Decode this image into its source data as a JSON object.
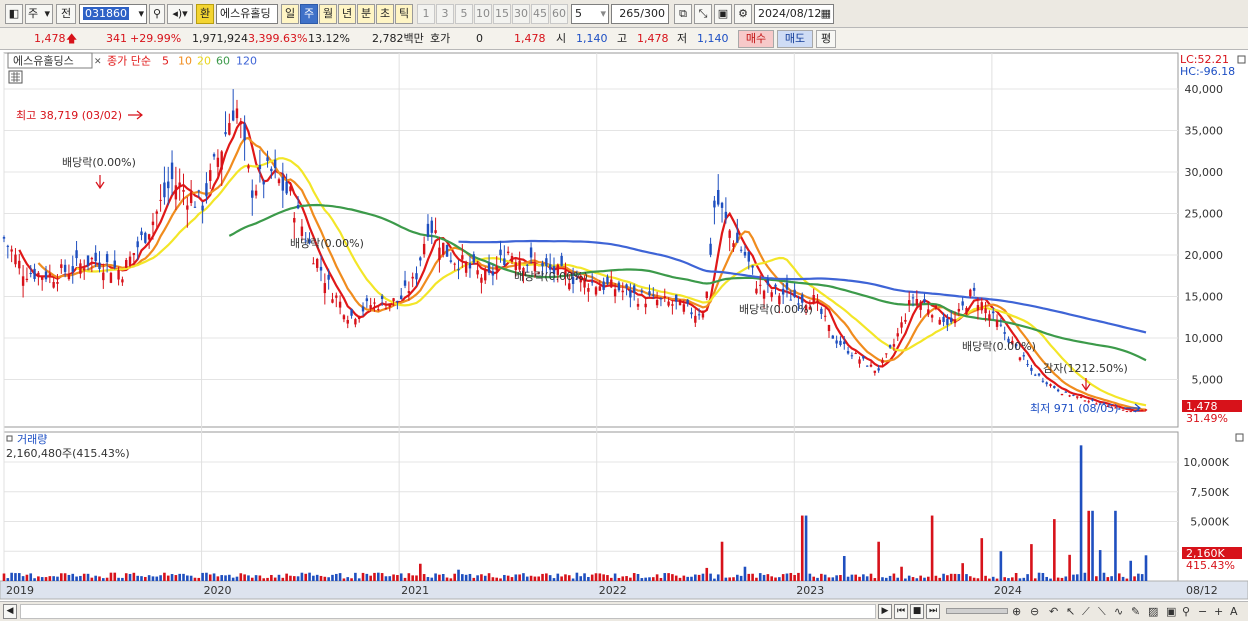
{
  "toolbar": {
    "market": "주",
    "jeon": "전",
    "code": "031860",
    "hwan": "환",
    "name": "에스유홀딩",
    "periods": [
      "일",
      "주",
      "월",
      "년",
      "분",
      "초",
      "틱"
    ],
    "active_period": "주",
    "intervals": [
      "1",
      "3",
      "5",
      "10",
      "15",
      "30",
      "45",
      "60"
    ],
    "interval_value": "5",
    "count": "265",
    "count_max": "/300",
    "date": "2024/08/12"
  },
  "quote": {
    "price": "1,478",
    "change": "341",
    "change_pct": "+29.99%",
    "volume": "1,971,924",
    "volume_ratio": "3,399.63%",
    "turnover": "13.12%",
    "amount": "2,782백만",
    "hoga_label": "호가",
    "hoga_value": "0",
    "hoga_price": "1,478",
    "open_label": "시",
    "open": "1,140",
    "high_label": "고",
    "high": "1,478",
    "low_label": "저",
    "low": "1,140",
    "buy_label": "매수",
    "sell_label": "매도",
    "pyeong_label": "평"
  },
  "legend": {
    "name": "에스유홀딩스",
    "series_label": "종가 단순",
    "ma": [
      "5",
      "10",
      "20",
      "60",
      "120"
    ],
    "ma_colors": [
      "#e01818",
      "#f08c1e",
      "#f3e628",
      "#3c9a4a",
      "#3e64d6"
    ]
  },
  "price_panel": {
    "lc": "LC:52.21",
    "hc": "HC:-96.18",
    "high_annotation": "최고 38,719 (03/02)",
    "low_annotation": "최저 971 (08/05)",
    "dividend_labels": [
      "배당락(0.00%)",
      "배당락(0.00%)",
      "배당락(0.00%)",
      "배당락(0.00%)",
      "배당락(0.00%)"
    ],
    "capital_reduction": "감자(1212.50%)",
    "current_price_tag": "1,478",
    "current_pct": "31.49%",
    "y_ticks": [
      "40,000",
      "35,000",
      "30,000",
      "25,000",
      "20,000",
      "15,000",
      "10,000",
      "5,000"
    ]
  },
  "volume_panel": {
    "title": "거래량",
    "summary": "2,160,480주(415.43%)",
    "y_ticks": [
      "10,000K",
      "7,500K",
      "5,000K",
      "2,500K"
    ],
    "current_tag": "2,160K",
    "current_pct": "415.43%"
  },
  "x_axis": [
    "2019",
    "2020",
    "2021",
    "2022",
    "2023",
    "2024",
    "08/12"
  ],
  "chart_data": {
    "type": "candlestick",
    "price_range": [
      0,
      40000
    ],
    "volume_range_k": [
      0,
      10000
    ],
    "close_path": [
      [
        2019.0,
        22000
      ],
      [
        2019.1,
        18000
      ],
      [
        2019.25,
        17500
      ],
      [
        2019.45,
        19500
      ],
      [
        2019.6,
        18000
      ],
      [
        2019.75,
        24000
      ],
      [
        2019.85,
        29000
      ],
      [
        2020.0,
        26000
      ],
      [
        2020.1,
        33000
      ],
      [
        2020.17,
        38719
      ],
      [
        2020.25,
        28000
      ],
      [
        2020.35,
        30000
      ],
      [
        2020.45,
        27000
      ],
      [
        2020.55,
        21000
      ],
      [
        2020.65,
        16000
      ],
      [
        2020.75,
        12500
      ],
      [
        2020.85,
        14000
      ],
      [
        2021.0,
        14500
      ],
      [
        2021.08,
        17000
      ],
      [
        2021.15,
        24000
      ],
      [
        2021.25,
        20000
      ],
      [
        2021.35,
        18500
      ],
      [
        2021.45,
        17000
      ],
      [
        2021.55,
        20500
      ],
      [
        2021.7,
        18500
      ],
      [
        2021.85,
        17500
      ],
      [
        2022.0,
        16500
      ],
      [
        2022.1,
        16000
      ],
      [
        2022.2,
        15000
      ],
      [
        2022.3,
        14500
      ],
      [
        2022.4,
        14000
      ],
      [
        2022.5,
        13000
      ],
      [
        2022.55,
        13500
      ],
      [
        2022.6,
        27000
      ],
      [
        2022.67,
        23000
      ],
      [
        2022.75,
        20000
      ],
      [
        2022.82,
        16000
      ],
      [
        2022.9,
        15500
      ],
      [
        2023.0,
        15000
      ],
      [
        2023.1,
        14500
      ],
      [
        2023.2,
        10000
      ],
      [
        2023.3,
        8000
      ],
      [
        2023.42,
        6000
      ],
      [
        2023.5,
        9000
      ],
      [
        2023.6,
        15000
      ],
      [
        2023.7,
        13500
      ],
      [
        2023.8,
        11500
      ],
      [
        2023.9,
        15500
      ],
      [
        2024.0,
        12500
      ],
      [
        2024.1,
        9500
      ],
      [
        2024.2,
        6000
      ],
      [
        2024.35,
        3500
      ],
      [
        2024.5,
        2400
      ],
      [
        2024.6,
        1800
      ],
      [
        2024.68,
        1200
      ],
      [
        2024.72,
        1140
      ],
      [
        2024.78,
        1478
      ]
    ],
    "volume_k": [
      [
        2019.3,
        650
      ],
      [
        2019.55,
        700
      ],
      [
        2019.9,
        600
      ],
      [
        2020.2,
        650
      ],
      [
        2020.55,
        700
      ],
      [
        2020.9,
        700
      ],
      [
        2021.1,
        1450
      ],
      [
        2021.3,
        950
      ],
      [
        2021.6,
        550
      ],
      [
        2022.0,
        650
      ],
      [
        2022.3,
        560
      ],
      [
        2022.55,
        1100
      ],
      [
        2022.63,
        3300
      ],
      [
        2022.75,
        1200
      ],
      [
        2022.95,
        580
      ],
      [
        2023.05,
        5500
      ],
      [
        2023.25,
        2100
      ],
      [
        2023.42,
        3300
      ],
      [
        2023.55,
        1200
      ],
      [
        2023.7,
        5500
      ],
      [
        2023.85,
        1500
      ],
      [
        2023.95,
        3600
      ],
      [
        2024.05,
        2500
      ],
      [
        2024.2,
        3100
      ],
      [
        2024.32,
        5200
      ],
      [
        2024.4,
        2200
      ],
      [
        2024.45,
        11400
      ],
      [
        2024.5,
        5900
      ],
      [
        2024.55,
        2600
      ],
      [
        2024.62,
        5900
      ],
      [
        2024.7,
        1700
      ],
      [
        2024.78,
        2160
      ]
    ]
  }
}
